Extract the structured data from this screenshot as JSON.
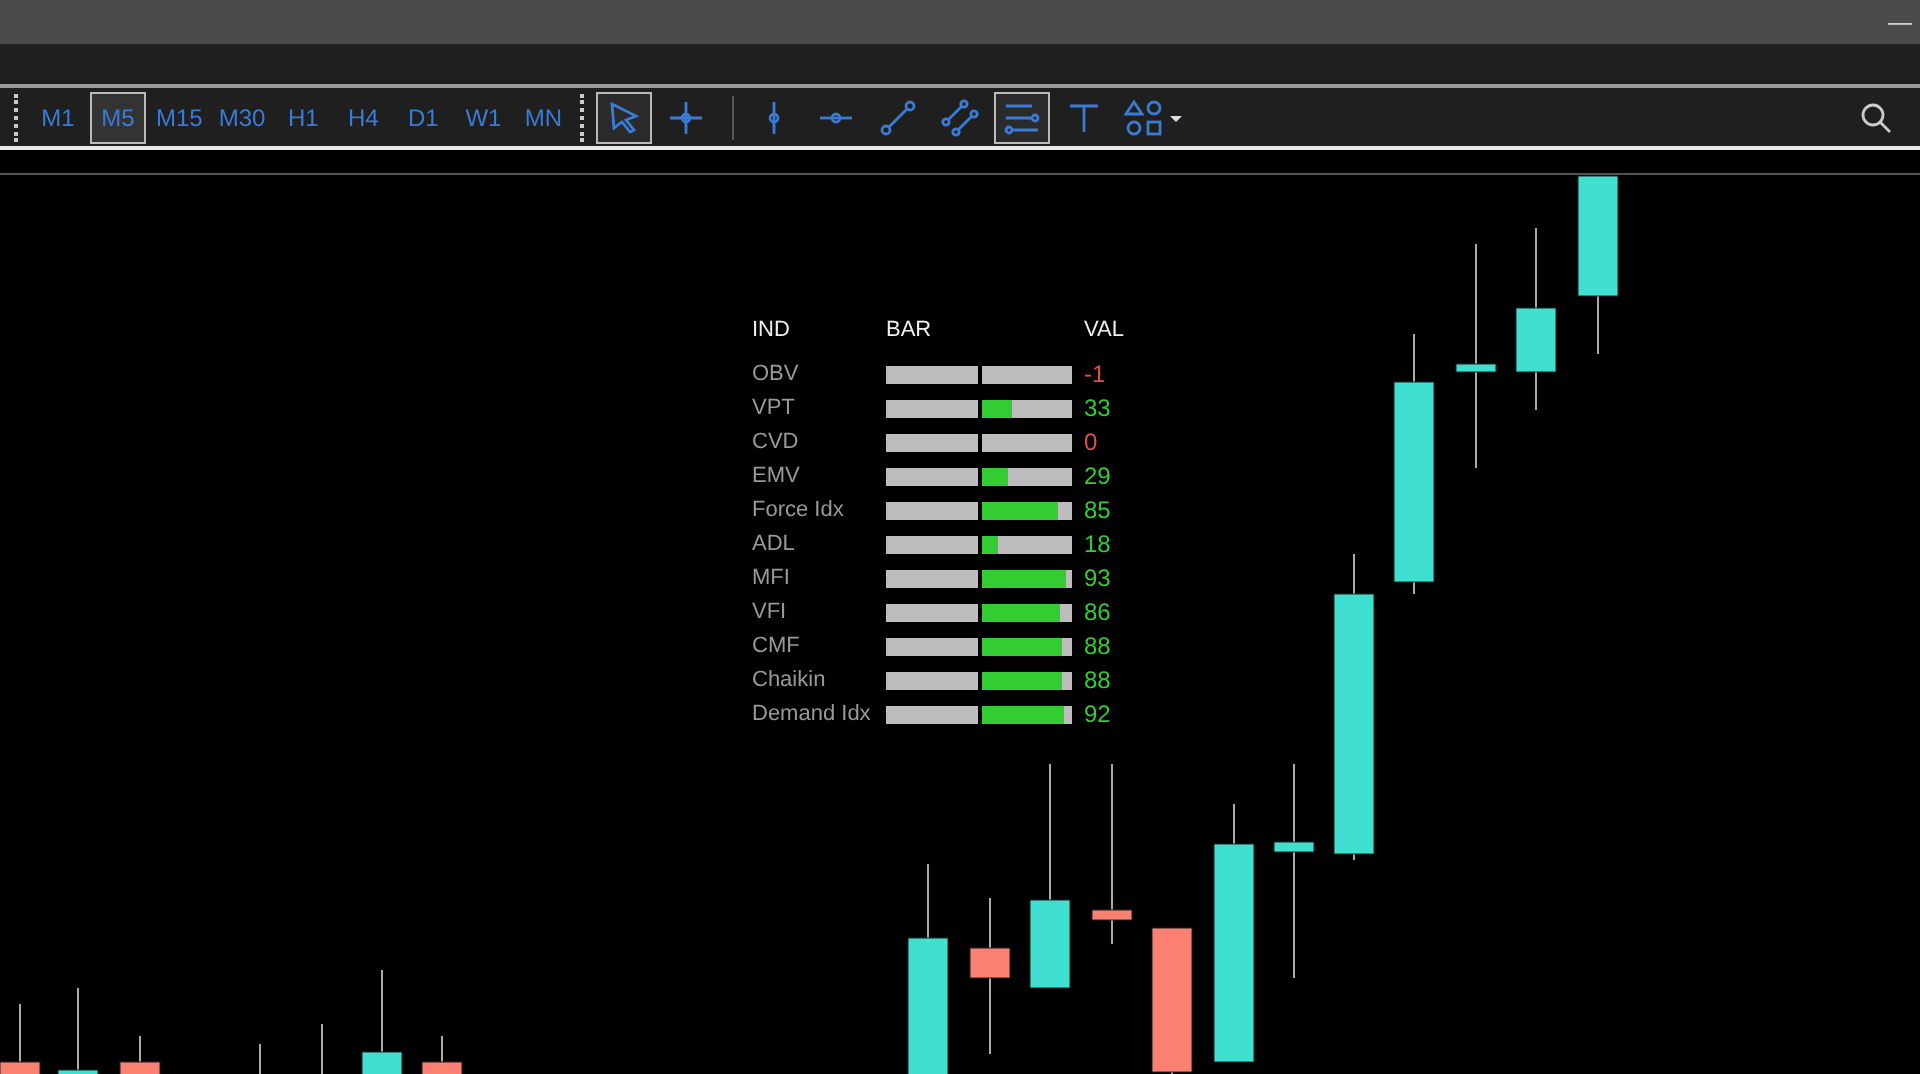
{
  "window": {
    "minimize": "—"
  },
  "timeframes": [
    {
      "label": "M1",
      "selected": false
    },
    {
      "label": "M5",
      "selected": true
    },
    {
      "label": "M15",
      "selected": false
    },
    {
      "label": "M30",
      "selected": false
    },
    {
      "label": "H1",
      "selected": false
    },
    {
      "label": "H4",
      "selected": false
    },
    {
      "label": "D1",
      "selected": false
    },
    {
      "label": "W1",
      "selected": false
    },
    {
      "label": "MN",
      "selected": false
    }
  ],
  "tools": [
    {
      "kind": "cursor",
      "selected": true
    },
    {
      "kind": "crosshair",
      "selected": false
    },
    {
      "kind": "vline",
      "selected": false
    },
    {
      "kind": "hline",
      "selected": false
    },
    {
      "kind": "trendline",
      "selected": false
    },
    {
      "kind": "channel",
      "selected": false
    },
    {
      "kind": "fibo",
      "selected": true
    },
    {
      "kind": "text",
      "selected": false
    },
    {
      "kind": "shapes",
      "selected": false
    }
  ],
  "indicator_panel": {
    "headers": [
      "IND",
      "BAR",
      "VAL"
    ],
    "rows": [
      {
        "name": "OBV",
        "value": "-1",
        "color": "#e0504a"
      },
      {
        "name": "VPT",
        "level": 0.33,
        "value": "33",
        "color": "#33cc33"
      },
      {
        "name": "CVD",
        "value": "0",
        "color": "#e0504a"
      },
      {
        "name": "EMV",
        "level": 0.29,
        "value": "29",
        "color": "#33cc33"
      },
      {
        "name": "Force Idx",
        "level": 0.85,
        "value": "85",
        "color": "#33cc33"
      },
      {
        "name": "ADL",
        "level": 0.18,
        "value": "18",
        "color": "#33cc33"
      },
      {
        "name": "MFI",
        "level": 0.93,
        "value": "93",
        "color": "#33cc33"
      },
      {
        "name": "VFI",
        "level": 0.86,
        "value": "86",
        "color": "#33cc33"
      },
      {
        "name": "CMF",
        "level": 0.88,
        "value": "88",
        "color": "#33cc33"
      },
      {
        "name": "Chaikin",
        "level": 0.88,
        "value": "88",
        "color": "#33cc33"
      },
      {
        "name": "Demand Idx",
        "level": 0.92,
        "value": "92",
        "color": "#33cc33"
      }
    ]
  }
}
